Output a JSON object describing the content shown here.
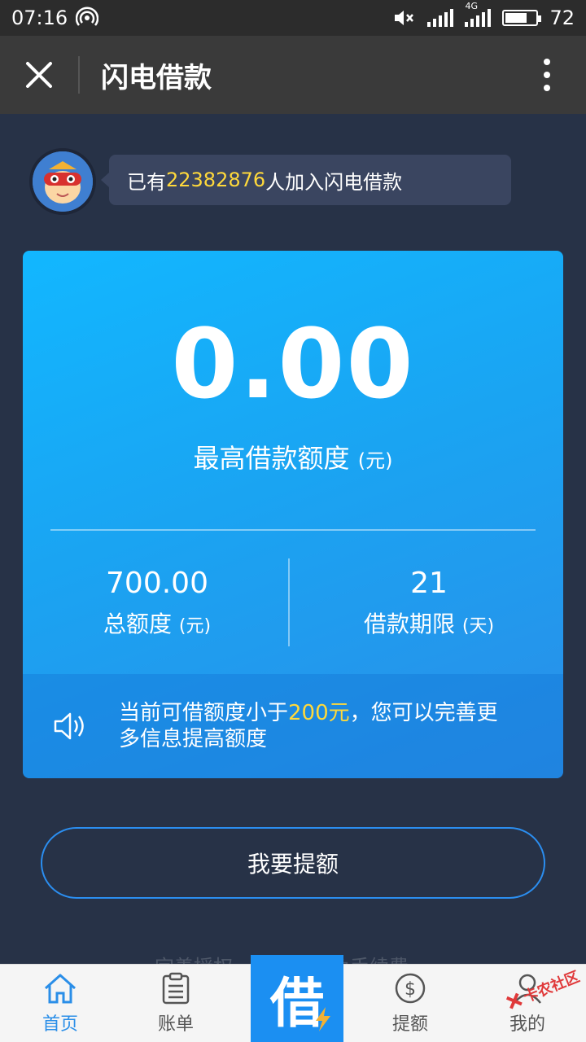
{
  "status_bar": {
    "time": "07:16",
    "network": "4G",
    "battery": "72"
  },
  "title_bar": {
    "close_icon": "close-icon",
    "title": "闪电借款",
    "more_icon": "more-vertical-icon"
  },
  "join": {
    "prefix": "已有",
    "count": "22382876",
    "suffix": "人加入闪电借款"
  },
  "card": {
    "amount": "0.00",
    "amount_label": "最高借款额度",
    "amount_unit": "(元)",
    "total_value": "700.00",
    "total_label": "总额度",
    "total_unit": "(元)",
    "term_value": "21",
    "term_label": "借款期限",
    "term_unit": "(天)",
    "notice_prefix": "当前可借额度小于",
    "notice_highlight": "200元",
    "notice_suffix": "，您可以完善更多信息提高额度"
  },
  "raise_button": "我要提额",
  "faded_text": "完善授权",
  "faded_text_2": "免手续费",
  "nav": {
    "home": "首页",
    "bill": "账单",
    "center": "借",
    "raise": "提额",
    "mine": "我的"
  },
  "watermark": "卡农社区",
  "colors": {
    "accent": "#1b8ff2",
    "highlight": "#ffd93b",
    "background": "#273247"
  }
}
